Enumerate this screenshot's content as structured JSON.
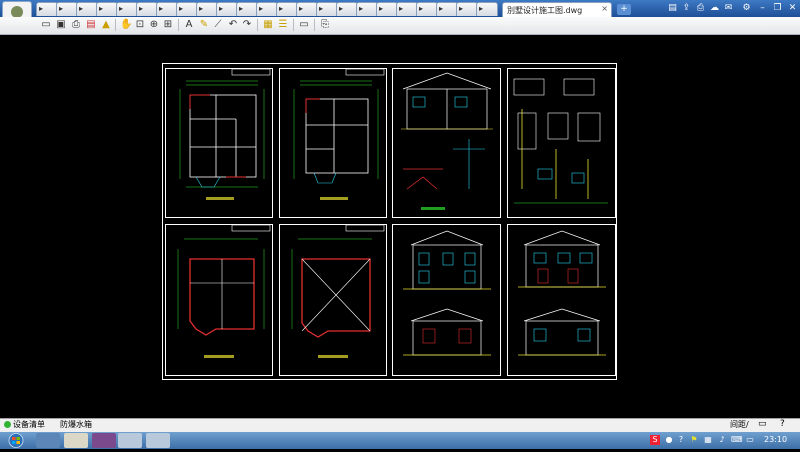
{
  "window": {
    "active_tab": "別墅设计施工图.dwg",
    "close_tab": "×",
    "new_tab": "+"
  },
  "titlebar_icons": [
    {
      "name": "folder-open-icon",
      "glyph": "▤"
    },
    {
      "name": "share-icon",
      "glyph": "⇪"
    },
    {
      "name": "print-icon",
      "glyph": "⎙"
    },
    {
      "name": "settings-icon",
      "glyph": "⚙"
    },
    {
      "name": "window-minimize-icon",
      "glyph": "–"
    },
    {
      "name": "window-restore-icon",
      "glyph": "❐"
    },
    {
      "name": "window-close-icon",
      "glyph": "✕"
    }
  ],
  "toolbar_icons": [
    {
      "name": "open-file-icon",
      "glyph": "📂"
    },
    {
      "name": "save-icon",
      "glyph": "💾"
    },
    {
      "name": "print-icon",
      "glyph": "🖶"
    },
    {
      "name": "export-icon",
      "glyph": "⇩"
    },
    {
      "name": "share-icon",
      "glyph": "⇪"
    },
    {
      "name": "lock-icon",
      "glyph": "🔒"
    },
    {
      "name": "hand-pan-icon",
      "glyph": "✋"
    },
    {
      "name": "zoom-window-icon",
      "glyph": "⊡"
    },
    {
      "name": "zoom-in-icon",
      "glyph": "⊕"
    },
    {
      "name": "zoom-extents-icon",
      "glyph": "⊞"
    },
    {
      "name": "text-tool-icon",
      "glyph": "A"
    },
    {
      "name": "pencil-icon",
      "glyph": "✎"
    },
    {
      "name": "measure-icon",
      "glyph": "⟋"
    },
    {
      "name": "undo-icon",
      "glyph": "↶"
    },
    {
      "name": "redo-icon",
      "glyph": "↷"
    },
    {
      "name": "layers-icon",
      "glyph": "▦"
    },
    {
      "name": "properties-icon",
      "glyph": "☰"
    },
    {
      "name": "layouts-icon",
      "glyph": "▭"
    },
    {
      "name": "export-pdf-icon",
      "glyph": "⎘"
    }
  ],
  "status": {
    "device_list": "设备清单",
    "watermark": "防爆水箱",
    "right_label": "间距/"
  },
  "taskbar": {
    "clock": "23:10"
  },
  "colors": {
    "drawing_background": "#000000",
    "linework_white": "#ffffff",
    "linework_green": "#2fe02f",
    "linework_cyan": "#2ad4f0",
    "linework_red": "#e33030",
    "linework_yellow": "#e8e030",
    "titlebar_blue": "#2b63ad"
  }
}
